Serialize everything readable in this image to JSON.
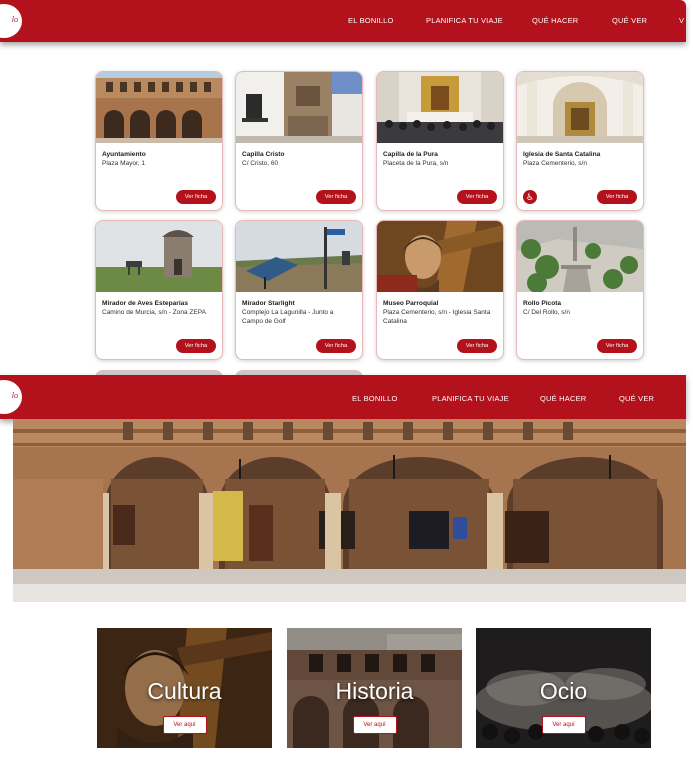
{
  "nav_top": {
    "logo_text": "lo",
    "items": [
      "EL BONILLO",
      "PLANIFICA TU VIAJE",
      "QUÉ HACER",
      "QUÉ VER",
      "V"
    ]
  },
  "cards": [
    {
      "title": "Ayuntamiento",
      "address": "Plaza Mayor, 1",
      "button": "Ver ficha"
    },
    {
      "title": "Capilla Cristo",
      "address": "C/ Cristo, 60",
      "button": "Ver ficha"
    },
    {
      "title": "Capilla de la Pura",
      "address": "Placeta de la Pura, s/n",
      "button": "Ver ficha"
    },
    {
      "title": "Iglesia de Santa Catalina",
      "address": "Plaza Cementerio, s/n",
      "button": "Ver ficha",
      "accessible_icon": "wheelchair-icon"
    },
    {
      "title": "Mirador de Aves Esteparias",
      "address": "Camino de Murcia, s/n - Zona ZEPA",
      "button": "Ver ficha"
    },
    {
      "title": "Mirador Starlight",
      "address": "Complejo La Lagunilla - Junto a Campo de Golf",
      "button": "Ver ficha"
    },
    {
      "title": "Museo Parroquial",
      "address": "Plaza Cementerio, s/n - Iglesia Santa Catalina",
      "button": "Ver ficha"
    },
    {
      "title": "Rollo Picota",
      "address": "C/ Del Rollo, s/n",
      "button": "Ver ficha"
    }
  ],
  "nav_bottom": {
    "logo_text": "lo",
    "items": [
      "EL BONILLO",
      "PLANIFICA TU VIAJE",
      "QUÉ HACER",
      "QUÉ VER"
    ]
  },
  "tiles": [
    {
      "label": "Cultura",
      "button": "Ver aquí"
    },
    {
      "label": "Historia",
      "button": "Ver aquí"
    },
    {
      "label": "Ocio",
      "button": "Ver aquí"
    }
  ],
  "colors": {
    "brand_red": "#b3111c",
    "card_border": "#e6b9bd"
  }
}
